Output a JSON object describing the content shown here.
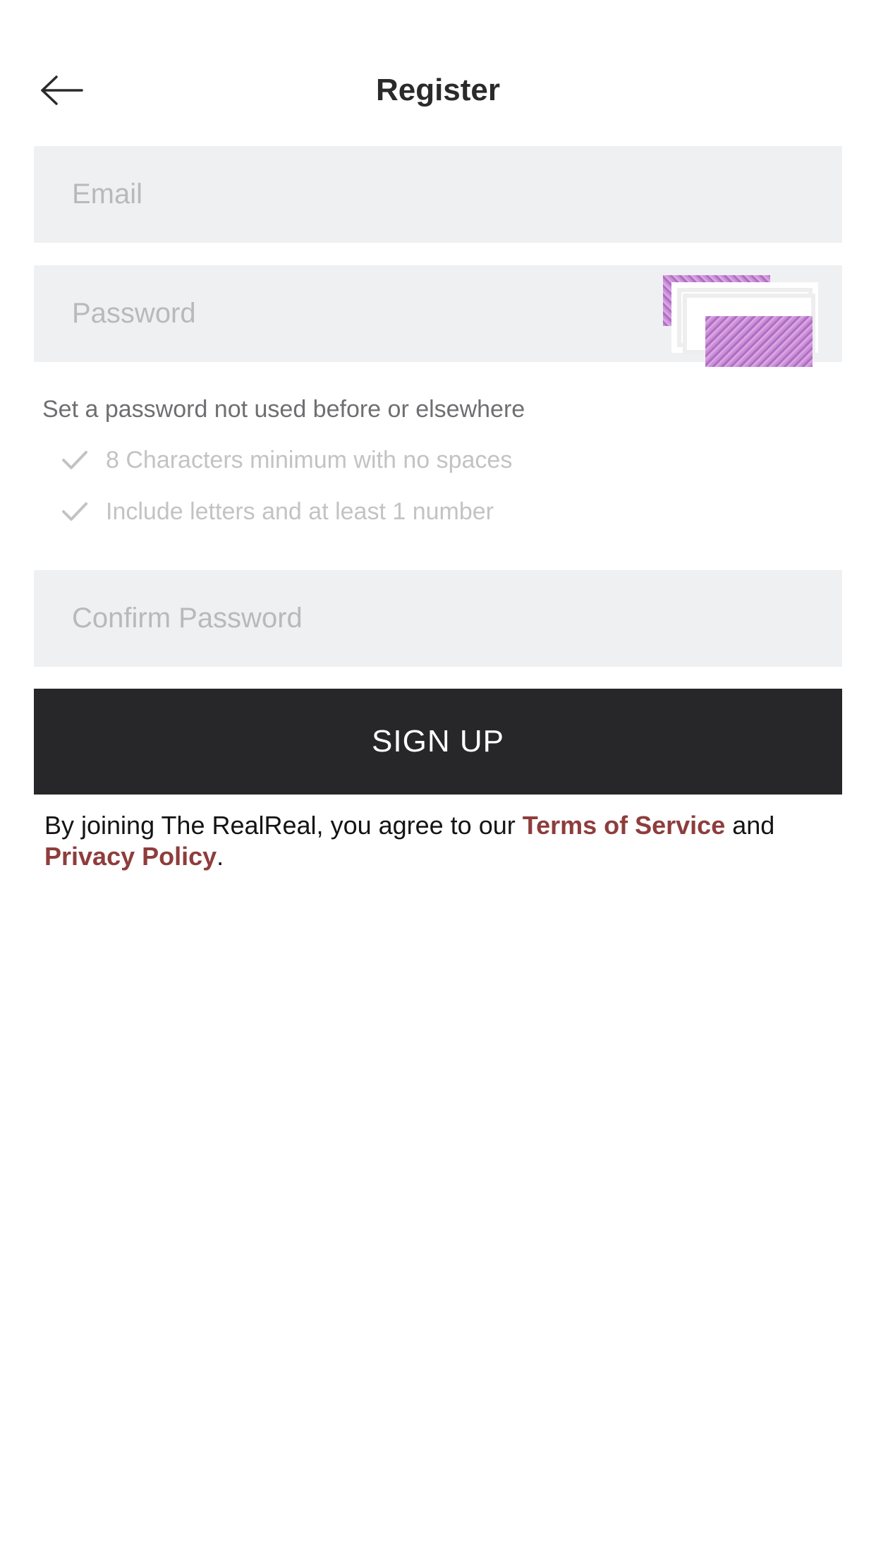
{
  "header": {
    "title": "Register",
    "back_icon": "arrow-left-icon"
  },
  "form": {
    "email_placeholder": "Email",
    "password_placeholder": "Password",
    "confirm_placeholder": "Confirm Password",
    "password_hint": "Set a password not used before or elsewhere",
    "rules": [
      "8 Characters minimum with no spaces",
      "Include letters and at least 1 number"
    ],
    "submit_label": "SIGN UP"
  },
  "legal": {
    "prefix": "By joining The RealReal, you agree to our ",
    "terms_link": "Terms of Service",
    "middle": " and",
    "privacy_link": "Privacy Policy",
    "suffix": "."
  },
  "colors": {
    "button_bg": "#27272a",
    "field_bg": "#eff0f2",
    "link": "#8e3d3c",
    "check": "#c3c3c6"
  }
}
